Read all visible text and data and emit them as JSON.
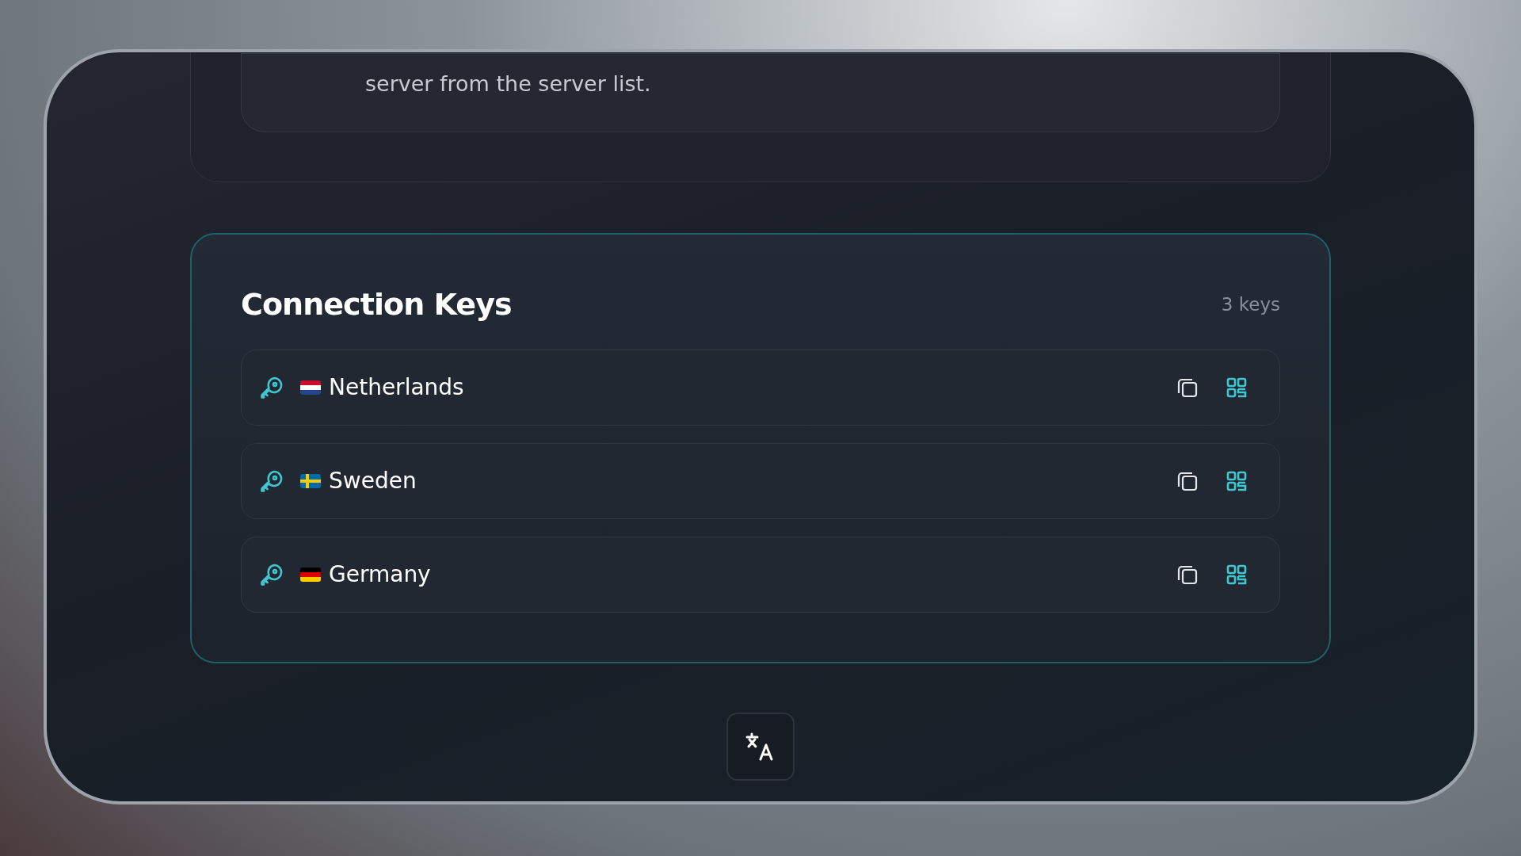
{
  "notice": {
    "text": "server from the server list."
  },
  "keys_panel": {
    "title": "Connection Keys",
    "count": "3 keys",
    "keys": [
      {
        "name": "Netherlands",
        "kind": "nl"
      },
      {
        "name": "Sweden",
        "kind": "se"
      },
      {
        "name": "Germany",
        "kind": "de"
      }
    ]
  }
}
